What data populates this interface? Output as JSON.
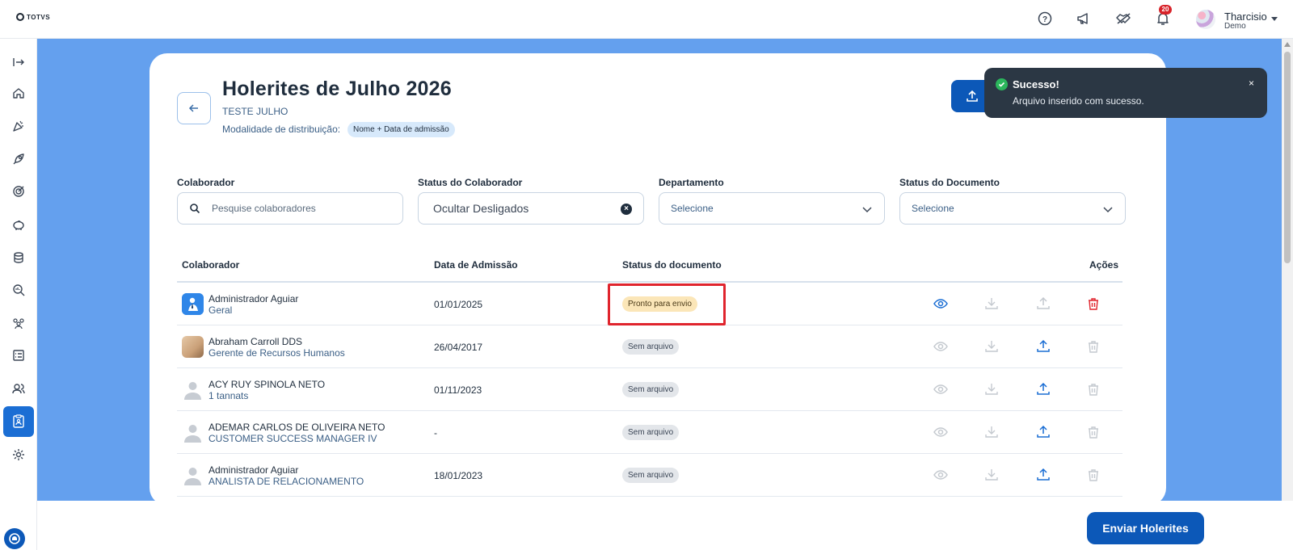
{
  "brand": {
    "logo_text": "TOTVS"
  },
  "topbar": {
    "notification_count": "20",
    "user_name": "Tharcisio",
    "user_sub": "Demo"
  },
  "page": {
    "title": "Holerites de Julho 2026",
    "subtitle": "TESTE JULHO",
    "distribution_label": "Modalidade de distribuição:",
    "distribution_chip": "Nome + Data de admissão"
  },
  "filters": {
    "collaborator": {
      "label": "Colaborador",
      "placeholder": "Pesquise colaboradores"
    },
    "collaborator_status": {
      "label": "Status do Colaborador",
      "value": "Ocultar Desligados"
    },
    "department": {
      "label": "Departamento",
      "value": "Selecione"
    },
    "document_status": {
      "label": "Status do Documento",
      "value": "Selecione"
    }
  },
  "table": {
    "headers": {
      "collaborator": "Colaborador",
      "admission": "Data de Admissão",
      "status": "Status do documento",
      "actions": "Ações"
    },
    "rows": [
      {
        "name": "Administrador Aguiar",
        "role": "Geral",
        "date": "01/01/2025",
        "status": "Pronto para envio",
        "status_kind": "warn",
        "avatar": "blue"
      },
      {
        "name": "Abraham Carroll DDS",
        "role": "Gerente de Recursos Humanos",
        "date": "26/04/2017",
        "status": "Sem arquivo",
        "status_kind": "gray",
        "avatar": "photo"
      },
      {
        "name": "ACY RUY SPINOLA NETO",
        "role": "1 tannats",
        "date": "01/11/2023",
        "status": "Sem arquivo",
        "status_kind": "gray",
        "avatar": "gray"
      },
      {
        "name": "ADEMAR CARLOS DE OLIVEIRA NETO",
        "role": "CUSTOMER SUCCESS MANAGER IV",
        "date": "-",
        "status": "Sem arquivo",
        "status_kind": "gray",
        "avatar": "gray"
      },
      {
        "name": "Administrador Aguiar",
        "role": "ANALISTA DE RELACIONAMENTO",
        "date": "18/01/2023",
        "status": "Sem arquivo",
        "status_kind": "gray",
        "avatar": "gray"
      }
    ]
  },
  "bottom": {
    "send_button": "Enviar Holerites"
  },
  "toast": {
    "title": "Sucesso!",
    "message": "Arquivo inserido com sucesso.",
    "close": "×"
  },
  "colors": {
    "primary": "#0c58b8",
    "background_blue": "#64a0ee",
    "danger": "#e0242d",
    "toast_bg": "#2b3744",
    "success": "#2bb65c"
  },
  "icons": {
    "sidebar": [
      "expand-icon",
      "home-icon",
      "celebration-icon",
      "rocket-icon",
      "target-icon",
      "piggy-bank-icon",
      "database-icon",
      "search-analytics-icon",
      "team-icon",
      "checklist-icon",
      "users-icon",
      "payslip-icon",
      "settings-icon"
    ],
    "topbar": [
      "help-icon",
      "megaphone-icon",
      "handshake-icon",
      "bell-icon"
    ],
    "row_actions": [
      "eye-icon",
      "download-icon",
      "upload-icon",
      "trash-icon"
    ]
  }
}
